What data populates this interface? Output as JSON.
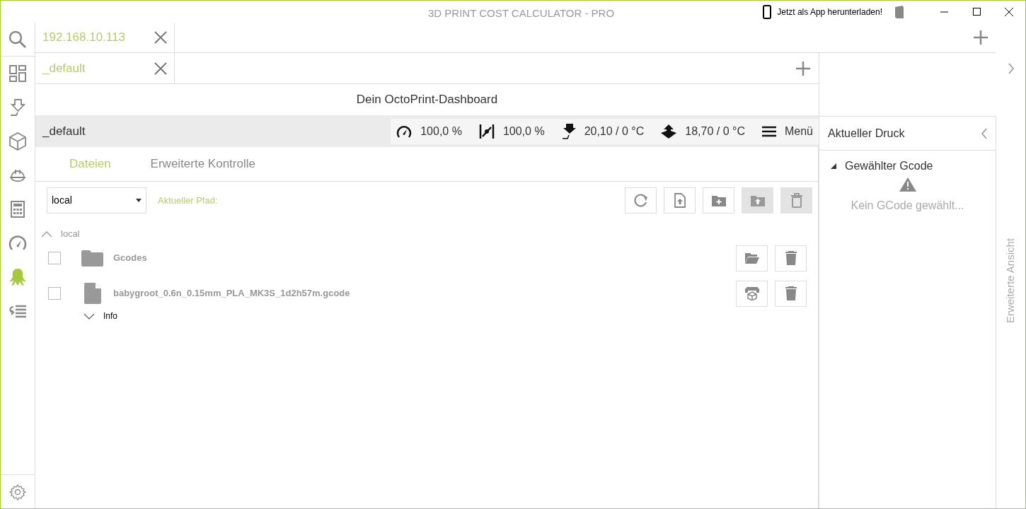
{
  "window": {
    "title": "3D PRINT COST CALCULATOR - PRO",
    "app_download": "Jetzt als App herunterladen!"
  },
  "sidebar": {
    "items": [
      {
        "kind": "search",
        "selected": false
      },
      {
        "kind": "dashboard",
        "selected": false
      },
      {
        "kind": "filament",
        "selected": false
      },
      {
        "kind": "cube",
        "selected": false
      },
      {
        "kind": "helmet",
        "selected": false
      },
      {
        "kind": "calculator",
        "selected": false
      },
      {
        "kind": "gauge",
        "selected": false
      },
      {
        "kind": "octopus",
        "selected": true
      },
      {
        "kind": "list",
        "selected": false
      }
    ]
  },
  "connection_tabs": [
    {
      "label": "192.168.10.113",
      "selected": true
    }
  ],
  "profile_tabs": [
    {
      "label": "_default",
      "selected": true
    }
  ],
  "dashboard_title": "Dein OctoPrint-Dashboard",
  "status_bar": {
    "profile": "_default",
    "readings": [
      {
        "kind": "speed",
        "value": "100,0 %"
      },
      {
        "kind": "flow",
        "value": "100,0 %"
      },
      {
        "kind": "nozzle",
        "value": "20,10 / 0 °C"
      },
      {
        "kind": "bed",
        "value": "18,70 / 0 °C"
      }
    ],
    "menu": "Menü"
  },
  "files_panel": {
    "tabs": [
      {
        "label": "Dateien",
        "selected": true
      },
      {
        "label": "Erweiterte Kontrolle",
        "selected": false
      }
    ],
    "storage_select": "local",
    "path_label": "Aktueller Pfad:",
    "toolbar": [
      {
        "kind": "refresh",
        "disabled": false
      },
      {
        "kind": "upload",
        "disabled": false
      },
      {
        "kind": "new-folder",
        "disabled": false
      },
      {
        "kind": "move",
        "disabled": true
      },
      {
        "kind": "delete",
        "disabled": true
      }
    ],
    "tree": {
      "label": "local",
      "expanded": true,
      "children": [
        {
          "kind": "folder",
          "name": "Gcodes",
          "checked": false
        },
        {
          "kind": "file",
          "name": "babygroot_0.6n_0.15mm_PLA_MK3S_1d2h57m.gcode",
          "checked": false,
          "info": {
            "label": "Info",
            "expanded": false
          }
        }
      ]
    }
  },
  "current_print": {
    "title": "Aktueller Druck",
    "section": {
      "label": "Gewählter Gcode",
      "expanded": true
    },
    "message": "Kein GCode gewählt..."
  },
  "side_panel": {
    "label": "Erweiterte Ansicht"
  }
}
